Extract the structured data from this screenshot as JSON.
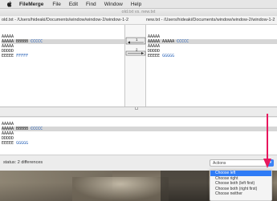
{
  "menubar": {
    "app_name": "FileMerge",
    "items": [
      "File",
      "Edit",
      "Find",
      "Window",
      "Help"
    ]
  },
  "window": {
    "title": "old.txt vs. new.txt",
    "left_path": "old.txt - /Users/hideaki/Documents/window/window-2/window-1-2",
    "right_path": "new.txt - /Users/hideaki/Documents/window/window-2/window-1-2"
  },
  "left_file": {
    "lines": [
      {
        "text": "AAAAA",
        "changed": false
      },
      {
        "text": "AAAAA BBBBB ",
        "hl": "CCCCC",
        "changed": true
      },
      {
        "text": "AAAAA",
        "changed": false
      },
      {
        "text": "DDDDD",
        "changed": false
      },
      {
        "text": "EEEEE ",
        "hl": "FFFFF",
        "changed": false
      }
    ]
  },
  "right_file": {
    "lines": [
      {
        "text": "AAAAA",
        "changed": false
      },
      {
        "text": "AAAAA AAAAA ",
        "hl": "CCCCC",
        "changed": true
      },
      {
        "text": "AAAAA",
        "changed": false
      },
      {
        "text": "DDDDD",
        "changed": false
      },
      {
        "text": "EEEEE ",
        "hl": "GGGGG",
        "changed": false
      }
    ]
  },
  "merge_markers": [
    "1",
    "2"
  ],
  "merge_output": {
    "lines": [
      {
        "text": "AAAAA",
        "changed": false
      },
      {
        "text": "AAAAA BBBBB ",
        "hl": "CCCCC",
        "changed": true
      },
      {
        "text": "AAAAA",
        "changed": false
      },
      {
        "text": "DDDDD",
        "changed": false
      },
      {
        "text": "EEEEE ",
        "hl": "GGGGG",
        "changed": false
      }
    ]
  },
  "status": {
    "text": "status: 2 differences"
  },
  "actions": {
    "label": "Actions",
    "options": [
      "Choose left",
      "Choose right",
      "Choose both (left first)",
      "Choose both (right first)",
      "Choose neither"
    ],
    "selected_index": 0
  },
  "colors": {
    "highlight_text": "#2a63b8",
    "selection": "#2f7cf6",
    "annotation_arrow": "#e8175d"
  }
}
